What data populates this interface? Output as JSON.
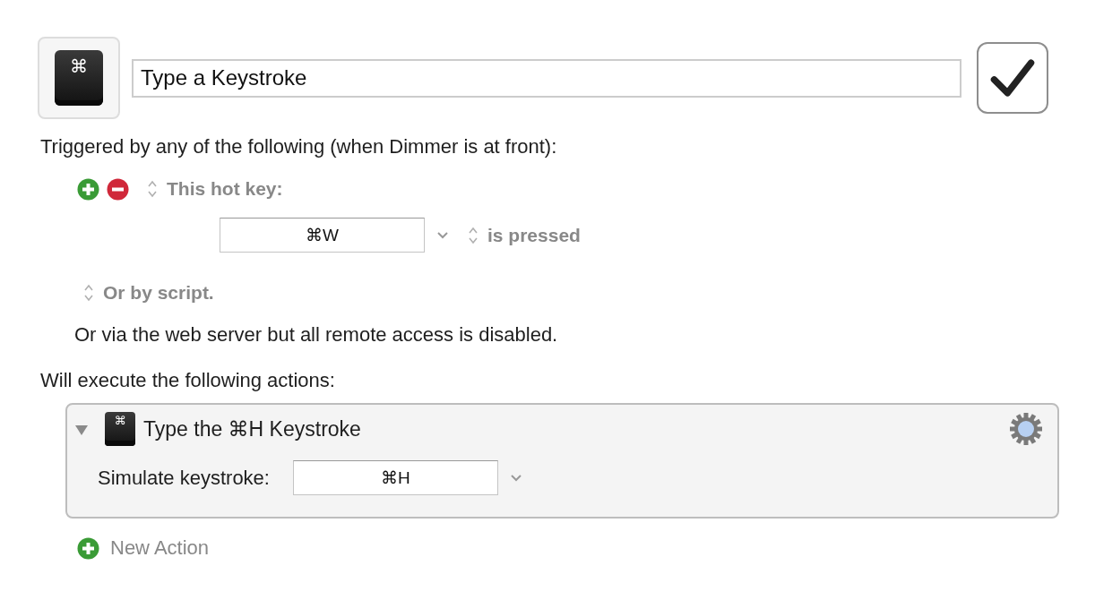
{
  "macro": {
    "icon_symbol": "⌘",
    "name": "Type a Keystroke",
    "enabled": true
  },
  "trigger_heading": "Triggered by any of the following (when Dimmer is at front):",
  "triggers": [
    {
      "kind": "hotkey",
      "label": "This hot key:",
      "key": "⌘W",
      "condition": "is pressed"
    },
    {
      "kind": "script",
      "label": "Or by script."
    }
  ],
  "web_server_note": "Or via the web server but all remote access is disabled.",
  "actions_heading": "Will execute the following actions:",
  "actions": [
    {
      "icon_symbol": "⌘",
      "title": "Type the ⌘H Keystroke",
      "expanded": true,
      "field_label": "Simulate keystroke:",
      "keystroke": "⌘H"
    }
  ],
  "new_action": "New Action"
}
